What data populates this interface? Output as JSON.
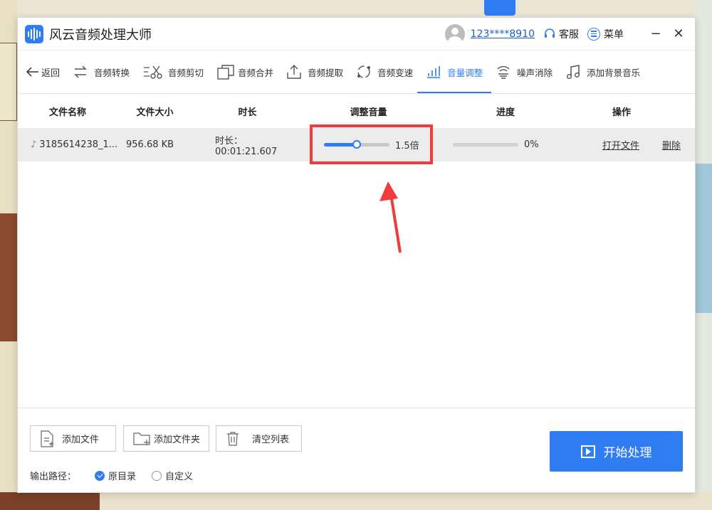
{
  "app": {
    "title": "风云音频处理大师",
    "user_id": "123****8910",
    "service_label": "客服",
    "menu_label": "菜单",
    "minimize": "−",
    "close": "✕"
  },
  "toolbar": {
    "back": "返回",
    "items": [
      {
        "label": "音频转换",
        "icon": "convert-icon"
      },
      {
        "label": "音频剪切",
        "icon": "scissors-icon"
      },
      {
        "label": "音频合并",
        "icon": "merge-icon"
      },
      {
        "label": "音频提取",
        "icon": "extract-icon"
      },
      {
        "label": "音频变速",
        "icon": "speed-icon"
      },
      {
        "label": "音量调整",
        "icon": "volume-bars-icon",
        "active": true
      },
      {
        "label": "噪声消除",
        "icon": "noise-icon"
      },
      {
        "label": "添加背景音乐",
        "icon": "music-note-icon"
      }
    ]
  },
  "table": {
    "headers": [
      "文件名称",
      "文件大小",
      "时长",
      "调整音量",
      "进度",
      "操作"
    ],
    "rows": [
      {
        "name": "3185614238_1...",
        "size": "956.68 KB",
        "duration": "时长：00:01:21.607",
        "volume_label": "1.5倍",
        "volume_fraction": 0.5,
        "progress_label": "0%",
        "progress_fraction": 0,
        "open_label": "打开文件",
        "delete_label": "删除"
      }
    ]
  },
  "bottom": {
    "add_file": "添加文件",
    "add_folder": "添加文件夹",
    "clear_list": "清空列表",
    "start": "开始处理",
    "output_label": "输出路径：",
    "option_original": "原目录",
    "option_custom": "自定义",
    "selected_option": "原目录"
  },
  "colors": {
    "accent": "#2f7df0",
    "highlight": "#f03c3c"
  }
}
